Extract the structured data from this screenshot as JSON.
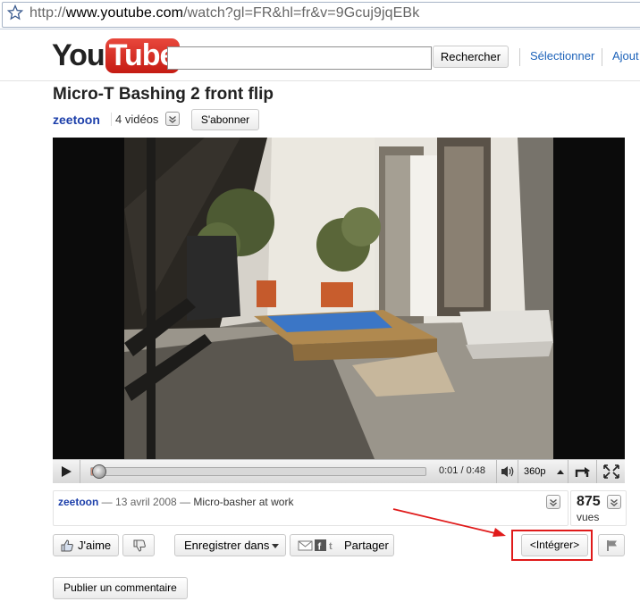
{
  "browser": {
    "url_prefix": "http://",
    "url_domain": "www.youtube.com",
    "url_path": "/watch?gl=FR&hl=fr&v=9Gcuj9jqEBk"
  },
  "header": {
    "logo_you": "You",
    "logo_tube": "Tube",
    "search_value": "",
    "search_button": "Rechercher",
    "select_link": "Sélectionner",
    "add_link": "Ajout"
  },
  "video": {
    "title": "Micro-T Bashing 2 front flip",
    "channel": "zeetoon",
    "video_count": "4 vidéos",
    "subscribe": "S'abonner",
    "time": "0:01 / 0:48",
    "quality": "360p",
    "progress_fraction": 0.02
  },
  "description": {
    "user": "zeetoon",
    "dash1": " — ",
    "date": "13 avril 2008",
    "dash2": " — ",
    "text": "Micro-basher at work"
  },
  "stats": {
    "views_count": "875",
    "views_label": "vues"
  },
  "actions": {
    "like": "J'aime",
    "save": "Enregistrer dans",
    "share": "Partager",
    "embed": "<Intégrer>",
    "comment": "Publier un commentaire"
  },
  "colors": {
    "link": "#1c3faa",
    "highlight": "#e01a1a",
    "progress": "#cf8e7b"
  }
}
